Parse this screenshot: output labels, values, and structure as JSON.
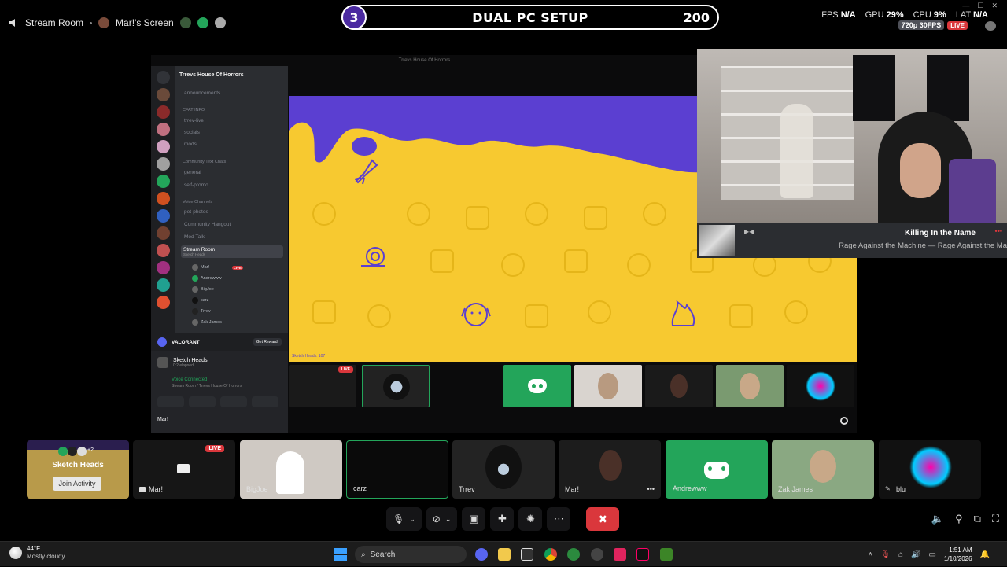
{
  "topbar": {
    "channel": "Stream Room",
    "screen_label": "Mar!'s Screen",
    "banner": {
      "number": "3",
      "title": "DUAL PC SETUP",
      "score": "200"
    },
    "stats": {
      "fps_label": "FPS",
      "fps_value": "N/A",
      "gpu_label": "GPU",
      "gpu_value": "29%",
      "cpu_label": "CPU",
      "cpu_value": "9%",
      "lat_label": "LAT",
      "lat_value": "N/A"
    },
    "quality": "720p 30FPS",
    "live": "LIVE"
  },
  "share": {
    "window_title": "Trrevs House Of Horrors",
    "server_name": "Trrevs House Of Horrors",
    "channels": {
      "announcements": "announcements",
      "cat_info": "CFAT INFO",
      "trrev_live": "trrev-live",
      "socials": "socials",
      "mods": "mods",
      "cat_text": "Community Text Chats",
      "general": "general",
      "self_promo": "self-promo",
      "cat_voice": "Voice Channels",
      "pet_photos": "pet-photos",
      "community_hangout": "Community Hangout",
      "mod_talk": "Mod Talk",
      "stream_room": "Stream Room",
      "stream_room_sub": "Sketch Heads"
    },
    "voice_users": [
      "Mar!",
      "Andrewww",
      "BigJoe",
      "carz",
      "Trrev",
      "Zak James"
    ],
    "voice_live": "LIVE",
    "valorant": "VALORANT",
    "get_reward": "Get Reward!",
    "activity_name": "Sketch Heads",
    "activity_sub": "0:2 elapsed",
    "voice_connected": "Voice Connected",
    "voice_path": "Stream Room / Trrevs House Of Horrors",
    "self_user": "Mar!",
    "canvas_footer": "Sketch Heads: 107"
  },
  "now_playing": {
    "title": "Killing In the Name",
    "subtitle": "Rage Against the Machine — Rage Against the Ma"
  },
  "tiles": {
    "activity": {
      "title": "Sketch Heads",
      "button": "Join Activity",
      "extra": "+2"
    },
    "mar_screen": {
      "name": "Mar!",
      "live": "LIVE"
    },
    "bigjoe": "BigJoe",
    "carz": "carz",
    "trrev": "Trrev",
    "mar": "Mar!",
    "andrewww": "Andrewww",
    "zak": "Zak James",
    "blu": "blu"
  },
  "taskbar": {
    "temp": "44°F",
    "weather": "Mostly cloudy",
    "search": "Search",
    "time": "1:51 AM",
    "date": "1/10/2026"
  },
  "colors": {
    "discord_blurple": "#5865f2",
    "discord_green": "#23a55a",
    "live_red": "#da373c",
    "canvas_yellow": "#f7c930",
    "canvas_purple": "#5b3fd1"
  }
}
